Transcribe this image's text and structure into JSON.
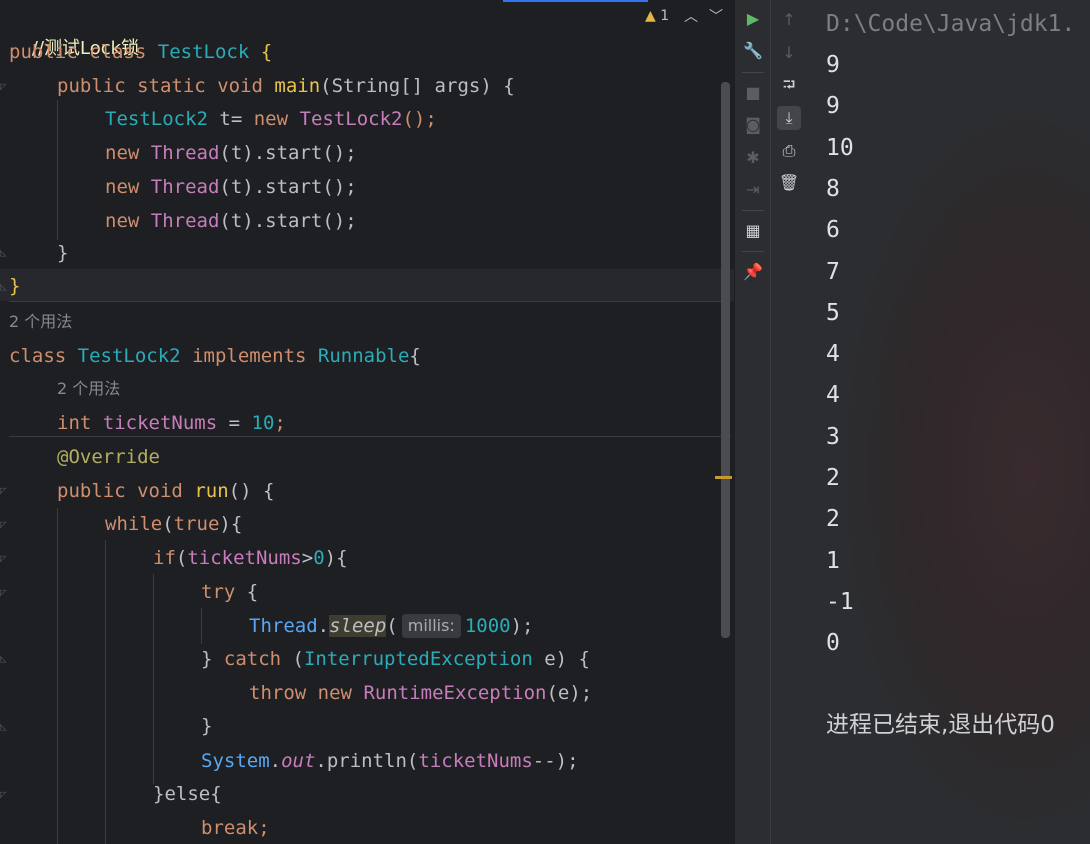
{
  "editor": {
    "warning_count": "1",
    "lines": {
      "comment": "//测试Lock锁",
      "l1_public": "public",
      "l1_class": "class",
      "l1_name": "TestLock",
      "l1_brace": "{",
      "l2_public": "public",
      "l2_static": "static",
      "l2_void": "void",
      "l2_main": "main",
      "l2_args": "(String[] args) {",
      "l3_type": "TestLock2",
      "l3_var": " t= ",
      "l3_new": "new",
      "l3_ctor": "TestLock2",
      "l3_rest": "();",
      "l4_new": "new",
      "l4_thread": "Thread",
      "l4_rest": "(t).start();",
      "l5_new": "new",
      "l5_thread": "Thread",
      "l5_rest": "(t).start();",
      "l6_new": "new",
      "l6_thread": "Thread",
      "l6_rest": "(t).start();",
      "l7_close": "}",
      "l8_close": "}",
      "usage1": "2 个用法",
      "l9_class": "class",
      "l9_name": "TestLock2",
      "l9_impl": "implements",
      "l9_iface": "Runnable",
      "l9_brace": "{",
      "usage2": "2 个用法",
      "l10_int": "int",
      "l10_field": "ticketNums",
      "l10_eq": " = ",
      "l10_num": "10",
      "l10_semi": ";",
      "l11_ann": "@Override",
      "l12_public": "public",
      "l12_void": "void",
      "l12_run": "run",
      "l12_rest": "() {",
      "l13_while": "while",
      "l13_open": "(",
      "l13_true": "true",
      "l13_close": "){",
      "l14_if": "if",
      "l14_open": "(",
      "l14_field": "ticketNums",
      "l14_gt": ">",
      "l14_zero": "0",
      "l14_close": "){",
      "l15_try": "try",
      "l15_brace": " {",
      "l16_thread": "Thread",
      "l16_dot": ".",
      "l16_sleep": "sleep",
      "l16_open": "(",
      "l16_hint": "millis:",
      "l16_num": "1000",
      "l16_close": ");",
      "l17_close": "} ",
      "l17_catch": "catch",
      "l17_open": " (",
      "l17_exc": "InterruptedException",
      "l17_e": " e) {",
      "l18_throw": "throw",
      "l18_new": "new",
      "l18_exc": "RuntimeException",
      "l18_rest": "(e);",
      "l19_close": "}",
      "l20_system": "System",
      "l20_dot": ".",
      "l20_out": "out",
      "l20_println": ".println(",
      "l20_field": "ticketNums",
      "l20_rest": "--);",
      "l21_else": "}else{",
      "l22_break": "break",
      "l22_semi": ";"
    }
  },
  "console": {
    "path": "D:\\Code\\Java\\jdk1.",
    "output": [
      "9",
      "9",
      "10",
      "8",
      "6",
      "7",
      "5",
      "4",
      "4",
      "3",
      "2",
      "2",
      "1",
      "-1",
      "0"
    ],
    "exit_message": "进程已结束,退出代码0"
  }
}
